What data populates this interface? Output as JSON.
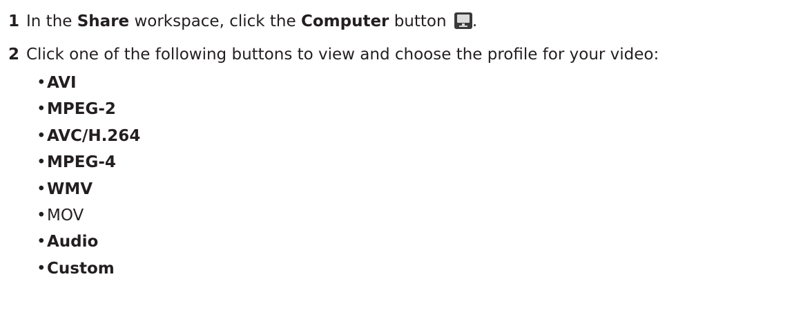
{
  "steps": [
    {
      "number": "1",
      "text_before": "In the ",
      "workspace": "Share",
      "text_middle": " workspace, click the ",
      "button": "Computer",
      "text_after": " button",
      "icon": "computer-icon",
      "end": "."
    },
    {
      "number": "2",
      "text": "Click one of the following buttons to view and choose the profile for your video:"
    }
  ],
  "bullet": "•",
  "formats": [
    {
      "label": "AVI",
      "bold": true
    },
    {
      "label": "MPEG-2",
      "bold": true
    },
    {
      "label": "AVC/H.264",
      "bold": true
    },
    {
      "label": "MPEG-4",
      "bold": true
    },
    {
      "label": "WMV",
      "bold": true
    },
    {
      "label": "MOV",
      "bold": false
    },
    {
      "label": "Audio",
      "bold": true
    },
    {
      "label": "Custom",
      "bold": true
    }
  ]
}
